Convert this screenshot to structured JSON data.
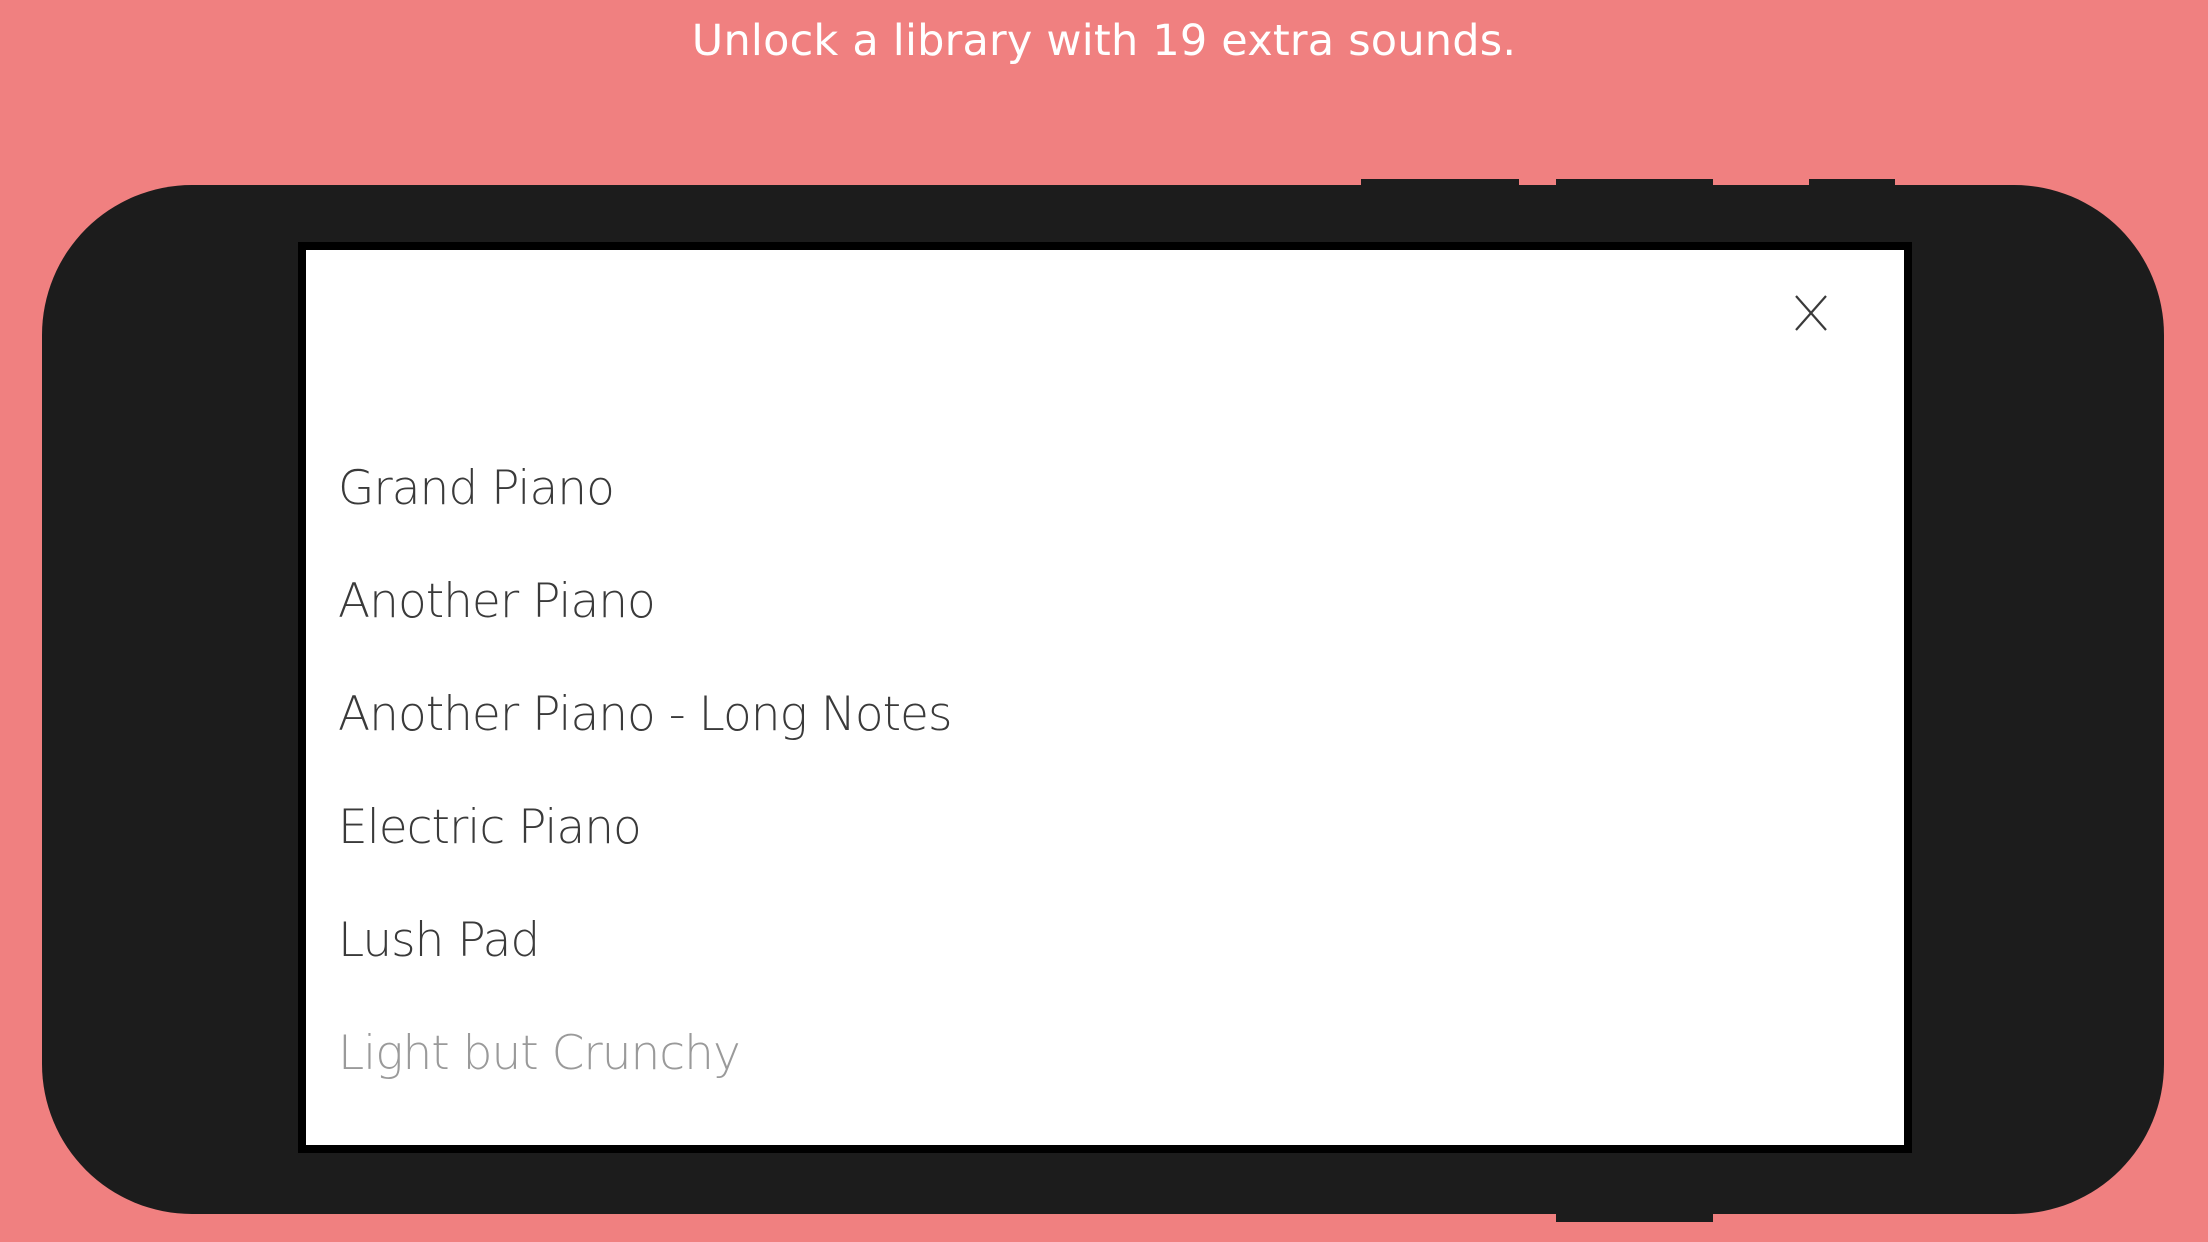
{
  "headline": "Unlock a library with 19 extra sounds.",
  "colors": {
    "background": "#f08080",
    "phone_body": "#1c1c1c",
    "screen": "#ffffff",
    "text": "#3a3a3a",
    "faded_text": "#9a9a9a"
  },
  "modal": {
    "close_icon": "close-x-icon",
    "sounds": [
      {
        "label": "Grand Piano"
      },
      {
        "label": "Another Piano"
      },
      {
        "label": "Another Piano - Long Notes"
      },
      {
        "label": "Electric Piano"
      },
      {
        "label": "Lush Pad"
      },
      {
        "label": "Light but Crunchy"
      }
    ]
  }
}
